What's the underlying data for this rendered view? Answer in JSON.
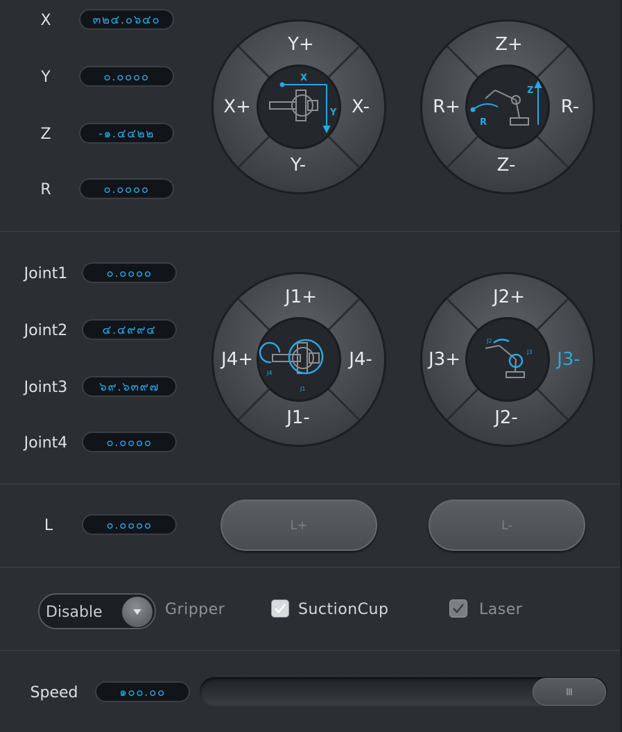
{
  "cartesian": [
    {
      "label": "X",
      "value": "๓๒๔.๐๖๔๐"
    },
    {
      "label": "Y",
      "value": "๐.๐๐๐๐"
    },
    {
      "label": "Z",
      "value": "-๑.๔๔๒๒"
    },
    {
      "label": "R",
      "value": "๐.๐๐๐๐"
    }
  ],
  "pad_xy": {
    "top": "Y+",
    "left": "X+",
    "right": "X-",
    "bottom": "Y-",
    "icon_x": "X",
    "icon_y": "Y"
  },
  "pad_zr": {
    "top": "Z+",
    "left": "R+",
    "right": "R-",
    "bottom": "Z-",
    "icon_z": "Z",
    "icon_r": "R"
  },
  "joints": [
    {
      "label": "Joint1",
      "value": "๐.๐๐๐๐"
    },
    {
      "label": "Joint2",
      "value": "๔.๔๙๙๔"
    },
    {
      "label": "Joint3",
      "value": "๖๙.๖๓๙๗"
    },
    {
      "label": "Joint4",
      "value": "๐.๐๐๐๐"
    }
  ],
  "pad_j14": {
    "top": "J1+",
    "left": "J4+",
    "right": "J4-",
    "bottom": "J1-",
    "icon_j1": "J1",
    "icon_j4": "J4"
  },
  "pad_j23": {
    "top": "J2+",
    "left": "J3+",
    "right": "J3-",
    "bottom": "J2-",
    "icon_j2": "J2",
    "icon_j3": "J3"
  },
  "rail": {
    "label": "L",
    "value": "๐.๐๐๐๐",
    "plus": "L+",
    "minus": "L-"
  },
  "endeffector": {
    "select_value": "Disable",
    "gripper_label": "Gripper",
    "suction_label": "SuctionCup",
    "suction_checked": true,
    "laser_label": "Laser",
    "laser_checked": true
  },
  "speed": {
    "label": "Speed",
    "value": "๑๐๐.๐๐",
    "level": 1.0
  },
  "colors": {
    "accent": "#2aa7e6",
    "bg": "#2b2e33",
    "field": "#111419"
  }
}
